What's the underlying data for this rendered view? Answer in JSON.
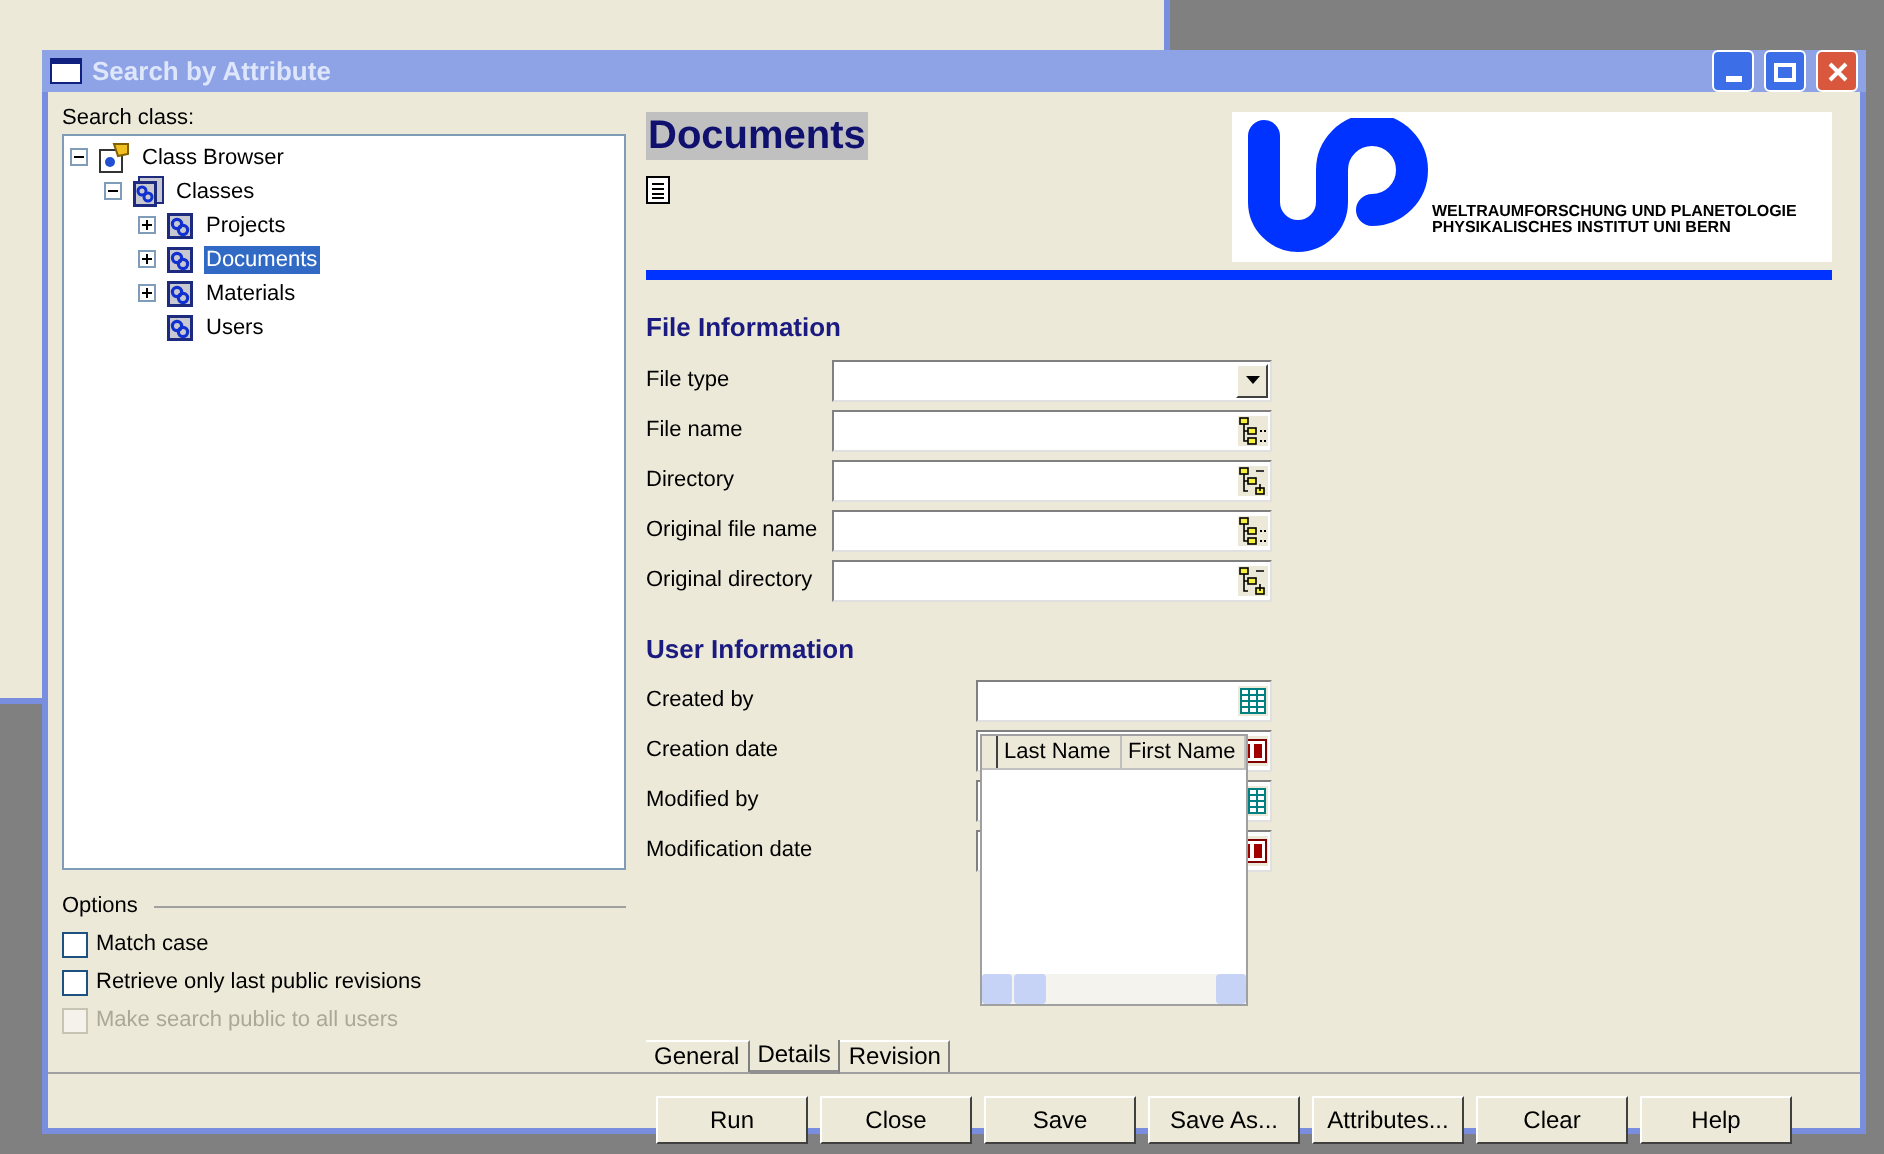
{
  "window": {
    "title": "Search by Attribute"
  },
  "search_class": {
    "label": "Search class:",
    "tree": [
      {
        "label": "Class Browser",
        "kind": "root",
        "expanded": true,
        "selected": false,
        "children": [
          {
            "label": "Classes",
            "kind": "folder",
            "expanded": true,
            "selected": false,
            "children": [
              {
                "label": "Projects",
                "kind": "class",
                "expanded": false,
                "selected": false
              },
              {
                "label": "Documents",
                "kind": "class",
                "expanded": false,
                "selected": true
              },
              {
                "label": "Materials",
                "kind": "class",
                "expanded": false,
                "selected": false
              },
              {
                "label": "Users",
                "kind": "class",
                "selected": false
              }
            ]
          }
        ]
      }
    ]
  },
  "options": {
    "label": "Options",
    "items": [
      {
        "label": "Match case",
        "checked": false,
        "disabled": false
      },
      {
        "label": "Retrieve only last public revisions",
        "checked": false,
        "disabled": false
      },
      {
        "label": "Make search public to all users",
        "checked": false,
        "disabled": true
      }
    ]
  },
  "header": {
    "title": "Documents",
    "logo": {
      "lines": [
        "WELTRAUMFORSCHUNG UND PLANETOLOGIE",
        "PHYSIKALISCHES INSTITUT UNI BERN"
      ]
    }
  },
  "sections": [
    {
      "title": "File Information",
      "fields": [
        {
          "label": "File type",
          "kind": "dropdown"
        },
        {
          "label": "File name",
          "kind": "file"
        },
        {
          "label": "Directory",
          "kind": "folder"
        },
        {
          "label": "Original file name",
          "kind": "file"
        },
        {
          "label": "Original directory",
          "kind": "folder"
        }
      ]
    },
    {
      "title": "User Information",
      "fields": [
        {
          "label": "Created by",
          "kind": "user"
        },
        {
          "label": "Creation date",
          "kind": "date"
        },
        {
          "label": "Modified by",
          "kind": "user"
        },
        {
          "label": "Modification date",
          "kind": "date"
        }
      ]
    }
  ],
  "popup": {
    "columns": [
      "Last Name",
      "First Name"
    ]
  },
  "tabs": [
    {
      "label": "General",
      "selected": false
    },
    {
      "label": "Details",
      "selected": true
    },
    {
      "label": "Revision",
      "selected": false
    }
  ],
  "buttons": [
    "Run",
    "Close",
    "Save",
    "Save As...",
    "Attributes...",
    "Clear",
    "Help"
  ]
}
